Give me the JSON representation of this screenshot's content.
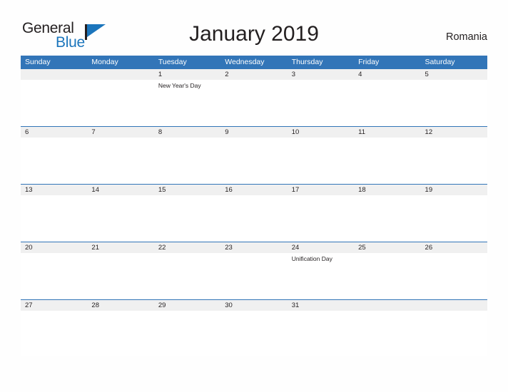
{
  "brand": {
    "name_part1": "General",
    "name_part2": "Blue",
    "flag_icon": "flag-icon",
    "accent_color": "#1b75bc"
  },
  "header": {
    "title": "January 2019",
    "country": "Romania"
  },
  "colors": {
    "header_blue": "#3275b8",
    "date_band_gray": "#f0f0f0",
    "text_dark": "#231f20",
    "logo_blue": "#1b75bc"
  },
  "calendar": {
    "month": "January",
    "year": "2019",
    "weekday_headers": [
      "Sunday",
      "Monday",
      "Tuesday",
      "Wednesday",
      "Thursday",
      "Friday",
      "Saturday"
    ],
    "weeks": [
      {
        "days": [
          {
            "number": "",
            "event": ""
          },
          {
            "number": "",
            "event": ""
          },
          {
            "number": "1",
            "event": "New Year's Day"
          },
          {
            "number": "2",
            "event": ""
          },
          {
            "number": "3",
            "event": ""
          },
          {
            "number": "4",
            "event": ""
          },
          {
            "number": "5",
            "event": ""
          }
        ]
      },
      {
        "days": [
          {
            "number": "6",
            "event": ""
          },
          {
            "number": "7",
            "event": ""
          },
          {
            "number": "8",
            "event": ""
          },
          {
            "number": "9",
            "event": ""
          },
          {
            "number": "10",
            "event": ""
          },
          {
            "number": "11",
            "event": ""
          },
          {
            "number": "12",
            "event": ""
          }
        ]
      },
      {
        "days": [
          {
            "number": "13",
            "event": ""
          },
          {
            "number": "14",
            "event": ""
          },
          {
            "number": "15",
            "event": ""
          },
          {
            "number": "16",
            "event": ""
          },
          {
            "number": "17",
            "event": ""
          },
          {
            "number": "18",
            "event": ""
          },
          {
            "number": "19",
            "event": ""
          }
        ]
      },
      {
        "days": [
          {
            "number": "20",
            "event": ""
          },
          {
            "number": "21",
            "event": ""
          },
          {
            "number": "22",
            "event": ""
          },
          {
            "number": "23",
            "event": ""
          },
          {
            "number": "24",
            "event": "Unification Day"
          },
          {
            "number": "25",
            "event": ""
          },
          {
            "number": "26",
            "event": ""
          }
        ]
      },
      {
        "days": [
          {
            "number": "27",
            "event": ""
          },
          {
            "number": "28",
            "event": ""
          },
          {
            "number": "29",
            "event": ""
          },
          {
            "number": "30",
            "event": ""
          },
          {
            "number": "31",
            "event": ""
          },
          {
            "number": "",
            "event": ""
          },
          {
            "number": "",
            "event": ""
          }
        ]
      }
    ],
    "holidays": [
      {
        "date": "1",
        "name": "New Year's Day"
      },
      {
        "date": "24",
        "name": "Unification Day"
      }
    ]
  }
}
